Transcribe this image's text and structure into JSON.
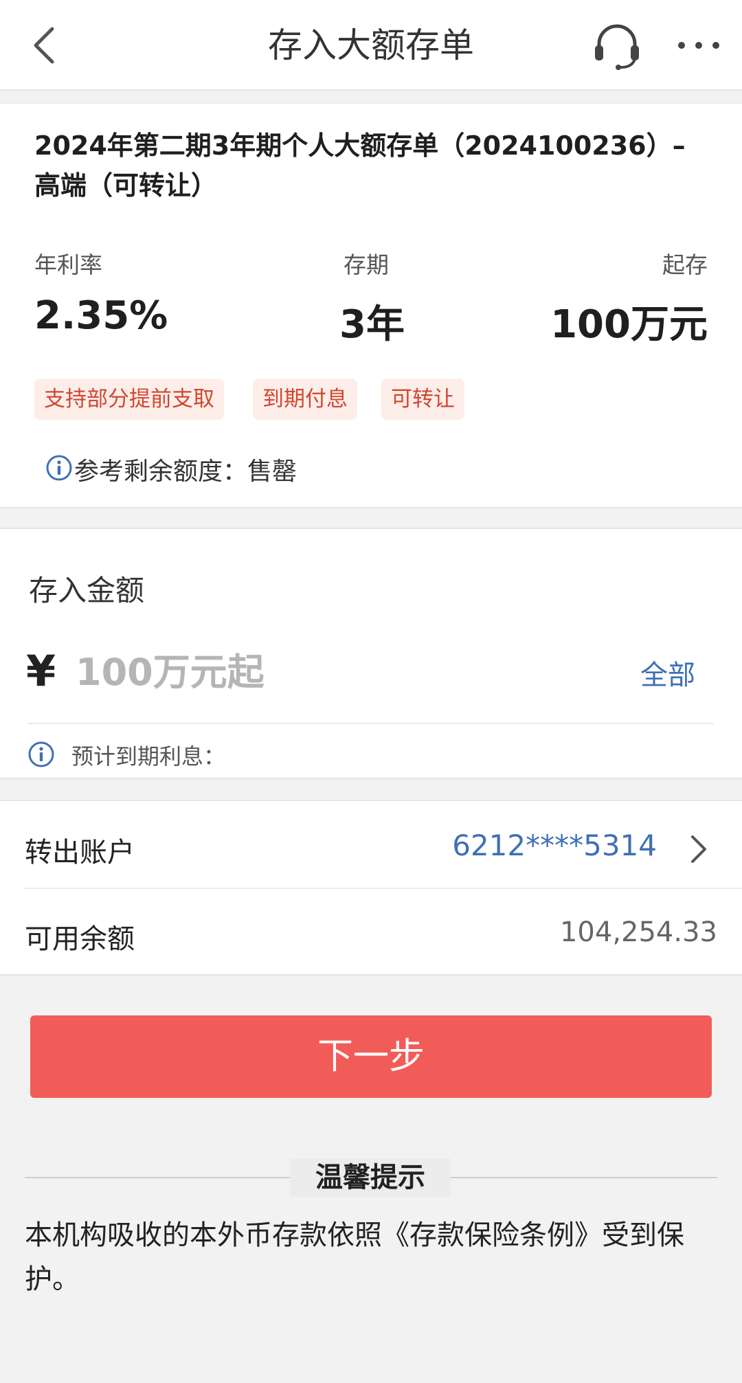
{
  "header": {
    "title": "存入大额存单"
  },
  "product": {
    "name": "2024年第二期3年期个人大额存单（2024100236）–高端（可转让）",
    "rate_label": "年利率",
    "rate_value": "2.35%",
    "term_label": "存期",
    "term_value": "3年",
    "min_label": "起存",
    "min_value": "100万元",
    "tags": [
      "支持部分提前支取",
      "到期付息",
      "可转让"
    ],
    "quota_text": "参考剩余额度：售罄"
  },
  "amount": {
    "title": "存入金额",
    "currency_symbol": "¥",
    "placeholder": "100万元起",
    "all_label": "全部",
    "interest_label": "预计到期利息："
  },
  "account": {
    "transfer_label": "转出账户",
    "account_number": "6212****5314",
    "balance_label": "可用余额",
    "balance_value": "104,254.33"
  },
  "actions": {
    "next_label": "下一步"
  },
  "tip": {
    "title": "温馨提示",
    "text": "本机构吸收的本外币存款依照《存款保险条例》受到保护。"
  },
  "colors": {
    "accent_blue": "#3f6fb6",
    "button_red": "#f25c58",
    "tag_red": "#d2462f",
    "tag_bg": "#fdeeea"
  },
  "icons": {
    "back": "chevron-left-icon",
    "service": "headset-icon",
    "more": "more-dots-icon",
    "info": "info-icon",
    "chevron": "chevron-right-icon"
  }
}
